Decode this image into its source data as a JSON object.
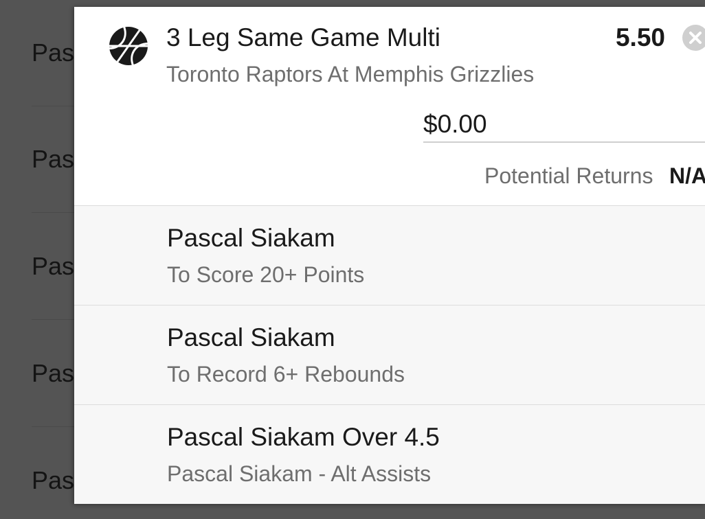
{
  "background_list": {
    "items": [
      "Pas",
      "Pas",
      "Pas",
      "Pas",
      "Pas"
    ]
  },
  "bet": {
    "icon": "basketball-icon",
    "title": "3 Leg Same Game Multi",
    "odds": "5.50",
    "match": "Toronto Raptors At Memphis Grizzlies",
    "stake": "$0.00",
    "returns_label": "Potential Returns",
    "returns_value": "N/A"
  },
  "legs": [
    {
      "title": "Pascal Siakam",
      "market": "To Score 20+ Points"
    },
    {
      "title": "Pascal Siakam",
      "market": "To Record 6+ Rebounds"
    },
    {
      "title": "Pascal Siakam Over 4.5",
      "market": "Pascal Siakam - Alt Assists"
    }
  ],
  "colors": {
    "overlay": "#545454",
    "panel": "#ffffff",
    "leg_background": "#f7f7f7",
    "secondary_text": "#6e6e6e"
  }
}
